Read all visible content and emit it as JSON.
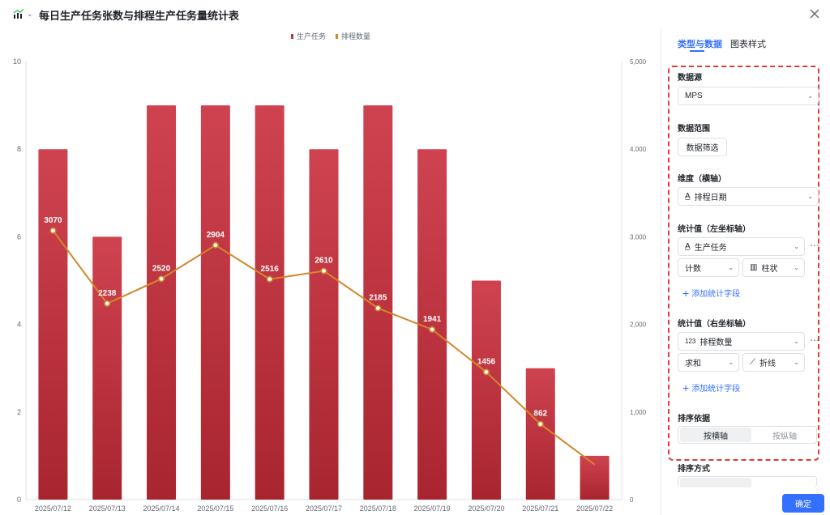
{
  "header": {
    "title": "每日生产任务张数与排程生产任务量统计表",
    "chart_icon": "chart-icon",
    "close_icon": "close-icon"
  },
  "panel": {
    "tabs": [
      "类型与数据",
      "图表样式"
    ],
    "datasource": {
      "label": "数据源",
      "value": "MPS"
    },
    "range": {
      "label": "数据范围",
      "button": "数据筛选"
    },
    "dimension": {
      "label": "维度（横轴）",
      "value": "排程日期"
    },
    "left_stat": {
      "label": "统计值（左坐标轴）",
      "field": "生产任务",
      "agg": "计数",
      "chart": "柱状",
      "add": "添加统计字段"
    },
    "right_stat": {
      "label": "统计值（右坐标轴）",
      "field_prefix": "123",
      "field": "排程数量",
      "agg": "求和",
      "chart": "折线",
      "add": "添加统计字段"
    },
    "sort_basis": {
      "label": "排序依据",
      "options": [
        "按横轴",
        "按纵轴"
      ]
    },
    "sort_method": {
      "label": "排序方式"
    },
    "confirm": "确定",
    "accent": "#3370ff",
    "highlight_border": "#e03c3c"
  },
  "chart_data": {
    "type": "bar",
    "categories": [
      "2025/07/12",
      "2025/07/13",
      "2025/07/14",
      "2025/07/15",
      "2025/07/16",
      "2025/07/17",
      "2025/07/18",
      "2025/07/19",
      "2025/07/20",
      "2025/07/21",
      "2025/07/22"
    ],
    "series": [
      {
        "name": "生产任务",
        "type": "bar",
        "axis": "left",
        "color": "#c2333f",
        "values": [
          8,
          6,
          9,
          9,
          9,
          8,
          9,
          8,
          5,
          3,
          1
        ]
      },
      {
        "name": "排程数量",
        "type": "line",
        "axis": "right",
        "color": "#d4862a",
        "values": [
          3070,
          2238,
          2520,
          2904,
          2516,
          2610,
          2185,
          1941,
          1456,
          862,
          400
        ],
        "labels": [
          "3070",
          "2238",
          "2520",
          "2904",
          "2516",
          "2610",
          "2185",
          "1941",
          "1456",
          "862",
          ""
        ]
      }
    ],
    "yleft": {
      "ticks": [
        "0",
        "2",
        "4",
        "6",
        "8",
        "10"
      ],
      "lim": [
        0,
        10
      ]
    },
    "yright": {
      "ticks": [
        "0",
        "1,000",
        "2,000",
        "3,000",
        "4,000",
        "5,000"
      ],
      "lim": [
        0,
        5000
      ]
    },
    "legend": "top-center",
    "grid": false
  }
}
